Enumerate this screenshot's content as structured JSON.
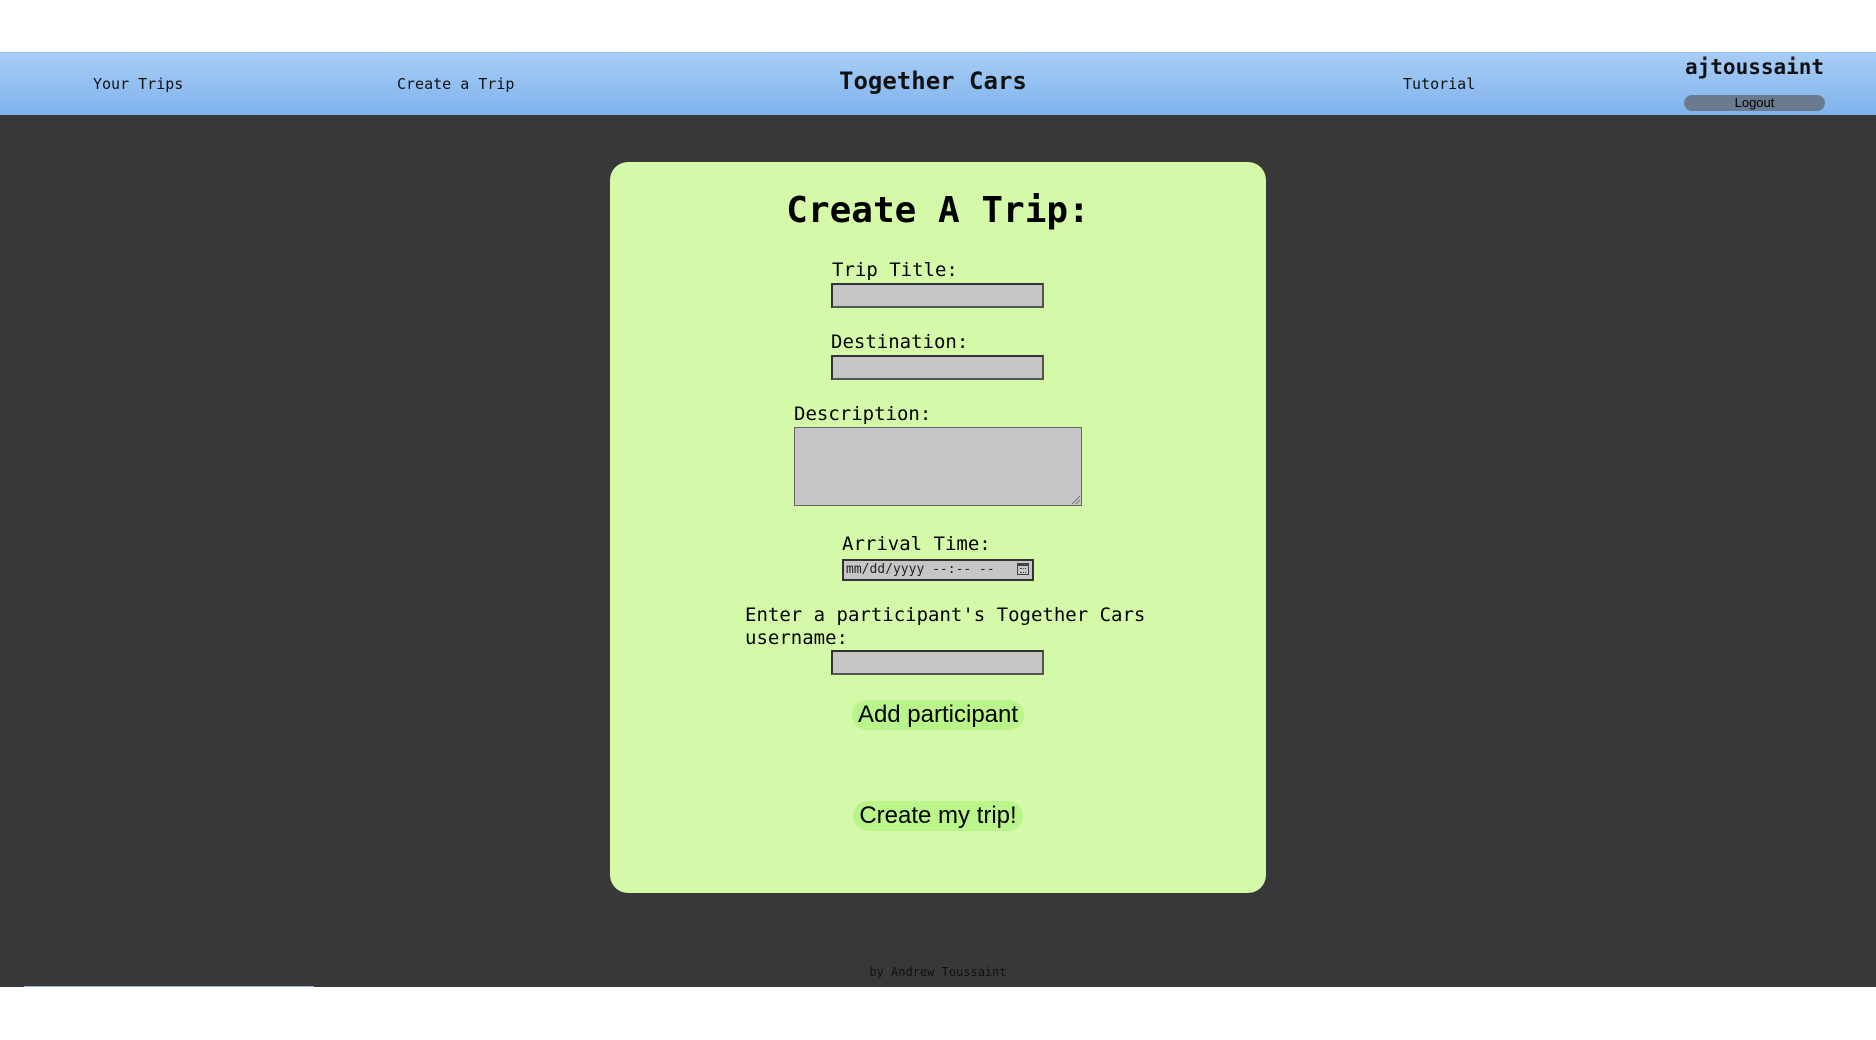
{
  "navbar": {
    "your_trips": "Your Trips",
    "create_trip": "Create a Trip",
    "app_title": "Together Cars",
    "tutorial": "Tutorial",
    "username": "ajtoussaint",
    "logout": "Logout"
  },
  "form": {
    "heading": "Create A Trip:",
    "trip_title_label": "Trip Title:",
    "trip_title_value": "",
    "destination_label": "Destination:",
    "destination_value": "",
    "description_label": "Description:",
    "description_value": "",
    "arrival_time_label": "Arrival Time:",
    "arrival_time_placeholder": "mm/dd/yyyy --:-- --",
    "participant_label_line1": "Enter a participant's Together Cars",
    "participant_label_line2": "username:",
    "participant_value": "",
    "add_participant_button": "Add participant",
    "create_trip_button": "Create my trip!"
  },
  "footer": {
    "credit": "by Andrew Toussaint"
  },
  "colors": {
    "navbar_gradient_top": "#a8cdf5",
    "navbar_gradient_bottom": "#7fb3ee",
    "page_background": "#383838",
    "card_background": "#d4f9a8",
    "button_background": "#b9f58a",
    "input_background": "#c6c6c6",
    "logout_background": "#6b7b8f"
  }
}
